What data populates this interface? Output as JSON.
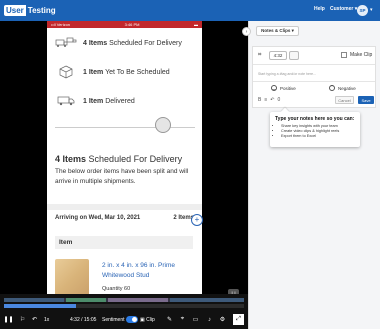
{
  "header": {
    "logo_user": "User",
    "logo_testing": "Testing",
    "help": "Help",
    "customer": "Customer",
    "customer_caret": "▾",
    "avatar": "SP",
    "account_caret": "▾"
  },
  "phone": {
    "status": {
      "carrier": "••ll Verizon",
      "time": "3:46 PM",
      "battery": "▬"
    },
    "rows": [
      {
        "count": "4 Items",
        "label": "Scheduled For Delivery",
        "icon": "trucks-icon"
      },
      {
        "count": "1 Item",
        "label": "Yet To Be Scheduled",
        "icon": "box-icon"
      },
      {
        "count": "1 Item",
        "label": "Delivered",
        "icon": "truck-icon"
      }
    ],
    "summary_count": "4 Items",
    "summary_label": "Scheduled For Delivery",
    "summary_desc": "The below order items have been split and will arrive in multiple shipments.",
    "arriving": "Arriving on Wed, Mar 10, 2021",
    "arriving_count": "2 Items",
    "item_header": "Item",
    "product_name": "2 in. x 4 in. x 96 in. Prime Whitewood Stud",
    "product_qty": "Quantity 60",
    "plus": "+",
    "badge": "U"
  },
  "controls": {
    "pause": "❚❚",
    "marker": "⚐",
    "speed": "1x",
    "time": "4:32 / 15:05",
    "sentiment": "Sentiment",
    "clip": "Clip",
    "fullscreen": "⤢"
  },
  "panel": {
    "collapse": "›",
    "tab_label": "Notes & Clips ▾",
    "time_value": "4:32",
    "make_clip": "Make Clip",
    "placeholder": "Start typing a #tag and/or note here...",
    "positive": "Positive",
    "negative": "Negative",
    "count": "0",
    "cancel": "Cancel",
    "save": "Save",
    "tip_title": "Type your notes here so you can:",
    "tip_items": [
      "Share key insights with your team",
      "Create video clips & highlight reels",
      "Export them to Excel"
    ]
  }
}
